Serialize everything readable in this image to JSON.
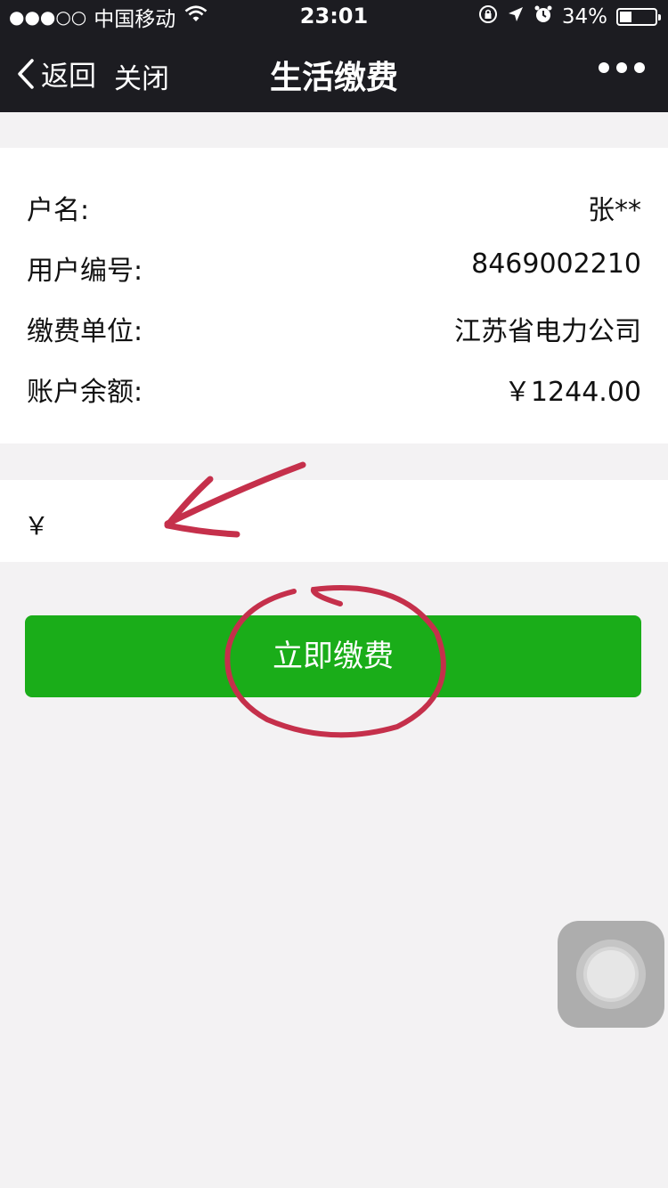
{
  "status_bar": {
    "signal_dots": "●●●○○",
    "carrier": "中国移动",
    "time": "23:01",
    "battery_percent": "34%",
    "battery_level": 0.34
  },
  "nav": {
    "back_label": "返回",
    "close_label": "关闭",
    "title": "生活缴费"
  },
  "info": {
    "rows": [
      {
        "label": "户名:",
        "value": "张**"
      },
      {
        "label": "用户编号:",
        "value": "8469002210"
      },
      {
        "label": "缴费单位:",
        "value": "江苏省电力公司"
      },
      {
        "label": "账户余额:",
        "value": "￥1244.00"
      }
    ]
  },
  "amount": {
    "prefix": "￥",
    "value": ""
  },
  "pay_button": {
    "label": "立即缴费"
  },
  "colors": {
    "nav_bg": "#1c1c21",
    "button_green": "#1aad19",
    "annotation_red": "#c5304b"
  }
}
